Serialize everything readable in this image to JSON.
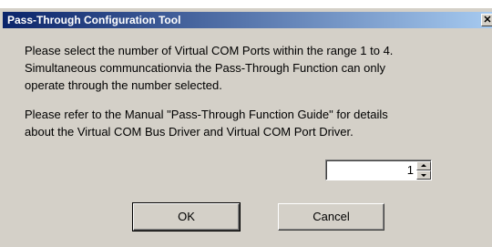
{
  "window": {
    "title": "Pass-Through Configuration Tool",
    "close_glyph": "✕"
  },
  "message": {
    "paragraph1": [
      "Please select the number of Virtual COM Ports within the range 1 to 4.",
      "Simultaneous communcationvia the Pass-Through Function can only",
      "operate through the number selected."
    ],
    "paragraph2": [
      "Please refer to the Manual \"Pass-Through Function Guide\" for details",
      "about the Virtual COM Bus Driver and Virtual COM Port Driver."
    ]
  },
  "port_count": {
    "value": "1",
    "up_icon": "spin-up-arrow-icon",
    "down_icon": "spin-down-arrow-icon"
  },
  "buttons": {
    "ok_label": "OK",
    "cancel_label": "Cancel"
  },
  "colors": {
    "titlebar_start": "#0a246a",
    "titlebar_end": "#a6caf0",
    "dialog_bg": "#d4d0c8"
  }
}
